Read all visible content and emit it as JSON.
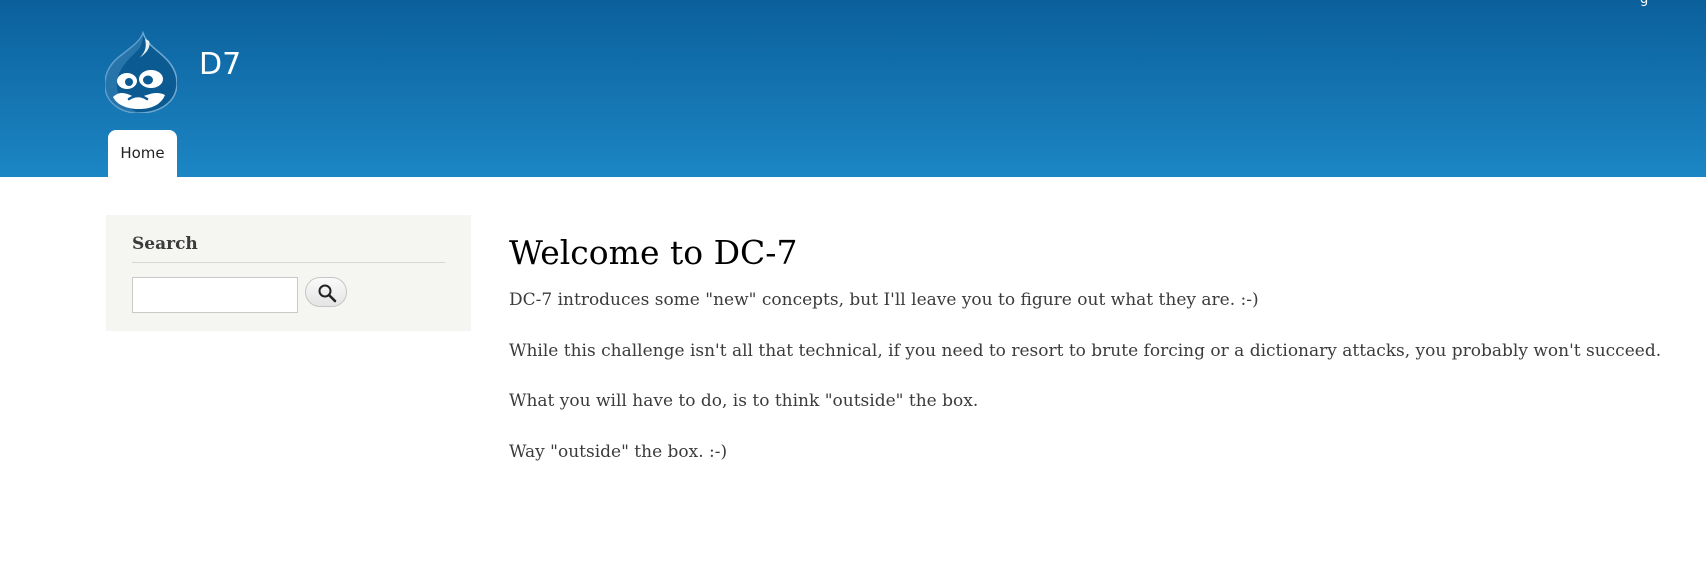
{
  "site": {
    "name": "D7",
    "logo_icon": "drupal-drop-logo-icon"
  },
  "header": {
    "user_link": "g"
  },
  "main_menu": {
    "items": [
      {
        "label": "Home",
        "active": true
      }
    ]
  },
  "sidebar": {
    "search_block": {
      "title": "Search",
      "input_value": "",
      "button_icon": "search-icon"
    }
  },
  "content": {
    "title": "Welcome to DC-7",
    "paragraphs": [
      "DC-7 introduces some \"new\" concepts, but I'll leave you to figure out what they are.  :-)",
      "While this challenge isn't all that technical, if you need to resort to brute forcing or a dictionary attacks, you probably won't succeed.",
      "What you will have to do, is to think \"outside\" the box.",
      "Way \"outside\" the box.  :-)"
    ]
  },
  "colors": {
    "header_top": "#0b609b",
    "header_bottom": "#1c86c4",
    "sidebar_bg": "#f5f5f2",
    "text": "#3b3b3b",
    "title": "#000000"
  }
}
